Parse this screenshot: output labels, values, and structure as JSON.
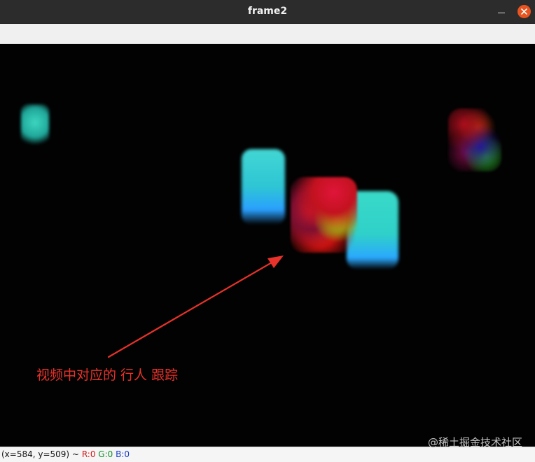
{
  "window": {
    "title": "frame2",
    "controls": {
      "minimize_icon": "minimize-icon",
      "close_icon": "close-icon"
    }
  },
  "canvas": {
    "annotation": {
      "text": "视频中对应的  行人 跟踪",
      "color": "#e8322a"
    }
  },
  "statusbar": {
    "coords": "(x=584, y=509) ~",
    "r": "R:0",
    "g": "G:0",
    "b": "B:0"
  },
  "watermark": {
    "text": "@稀土掘金技术社区"
  }
}
